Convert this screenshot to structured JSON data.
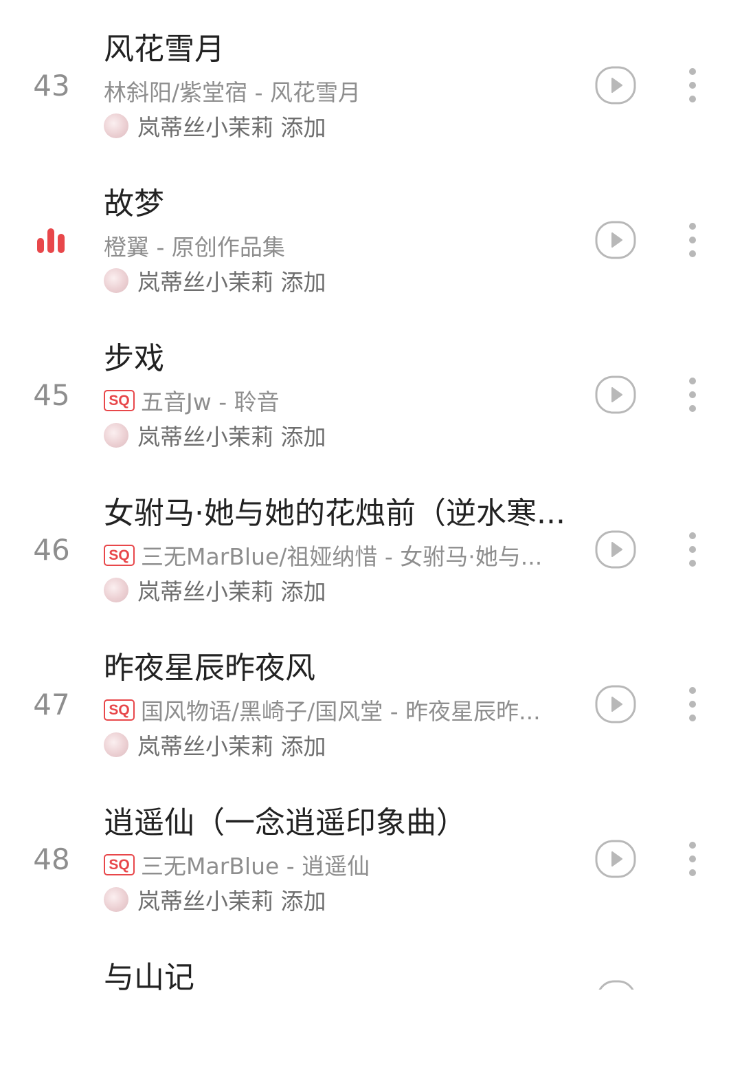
{
  "songs": [
    {
      "index": "43",
      "playing": false,
      "title": "风花雪月",
      "quality_badge": "",
      "artist_album": "林斜阳/紫堂宿 - 风花雪月",
      "added_by": "岚蒂丝小茉莉 添加"
    },
    {
      "index": "",
      "playing": true,
      "title": "故梦",
      "quality_badge": "",
      "artist_album": "橙翼 - 原创作品集",
      "added_by": "岚蒂丝小茉莉 添加"
    },
    {
      "index": "45",
      "playing": false,
      "title": "步戏",
      "quality_badge": "SQ",
      "artist_album": "五音Jw - 聆音",
      "added_by": "岚蒂丝小茉莉 添加"
    },
    {
      "index": "46",
      "playing": false,
      "title": "女驸马·她与她的花烛前（逆水寒...",
      "quality_badge": "SQ",
      "artist_album": "三无MarBlue/祖娅纳惜 - 女驸马·她与...",
      "added_by": "岚蒂丝小茉莉 添加"
    },
    {
      "index": "47",
      "playing": false,
      "title": "昨夜星辰昨夜风",
      "quality_badge": "SQ",
      "artist_album": "国风物语/黑崎子/国风堂 - 昨夜星辰昨...",
      "added_by": "岚蒂丝小茉莉 添加"
    },
    {
      "index": "48",
      "playing": false,
      "title": "逍遥仙（一念逍遥印象曲）",
      "quality_badge": "SQ",
      "artist_album": "三无MarBlue - 逍遥仙",
      "added_by": "岚蒂丝小茉莉 添加"
    },
    {
      "index": "",
      "playing": false,
      "title": "与山记",
      "quality_badge": "",
      "artist_album": "",
      "added_by": ""
    }
  ],
  "icons": {
    "playing_indicator": "sound-bars-icon",
    "play": "play-circle-icon",
    "more": "more-vertical-icon"
  },
  "colors": {
    "accent": "#e8474a",
    "title": "#222222",
    "secondary": "#8e8e8e",
    "icon": "#b8b8b8"
  }
}
